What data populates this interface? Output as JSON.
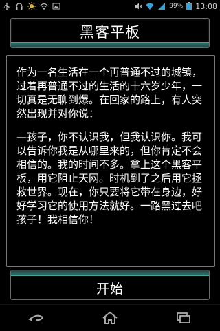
{
  "status_bar": {
    "battery_pct": "99%",
    "time": "13:08",
    "left_icons": [
      "usb-icon",
      "headphone-icon",
      "brightness-icon",
      "wifi-signal-icon",
      "image-icon"
    ],
    "right_icons": [
      "mute-icon",
      "wifi-icon",
      "signal-icon",
      "battery-icon"
    ]
  },
  "app": {
    "title": "黑客平板",
    "start_button": "开始",
    "accent_color": "#2f6f6a"
  },
  "story": {
    "paragraphs": [
      "作为一名生活在一个再普通不过的城镇，过着再普通不过的生活的十六岁少年，一切真是无聊到爆。在回家的路上，有人突然出现并对你说：",
      "—孩子，你不认识我，但我认识你。我可以告诉你我是从哪里来的，但你肯定不会相信的。我的时间不多。拿上这个黑客平板，用它阻止天网。时机到了之后用它拯救世界。现在，你只要将它带在身边，好好学习它的使用方法就好。一路黑过去吧孩子！我相信你！"
    ]
  },
  "nav": {
    "back": "back-icon",
    "home": "home-icon",
    "recent": "recent-apps-icon"
  }
}
